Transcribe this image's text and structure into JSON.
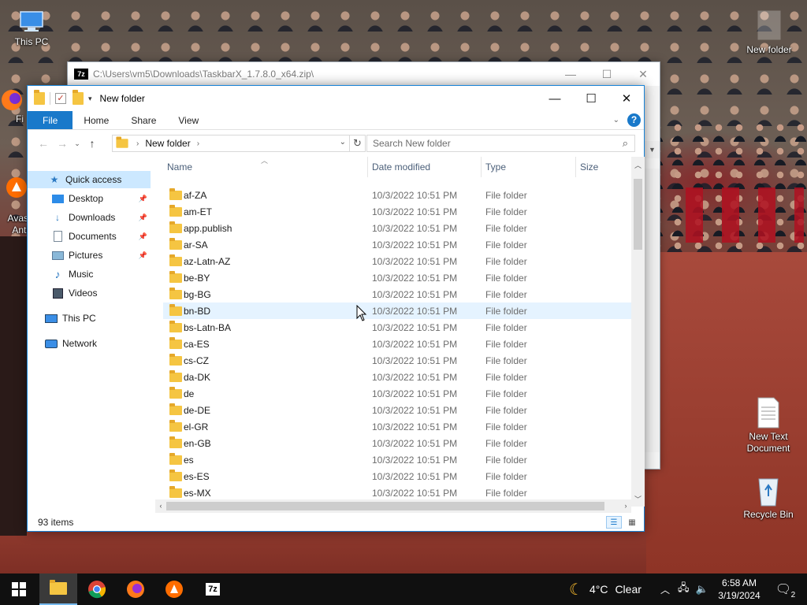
{
  "desktop": {
    "icons": {
      "this_pc": "This PC",
      "new_folder": "New folder",
      "new_text_document": "New Text Document",
      "recycle_bin": "Recycle Bin",
      "avast_partial": "Avas\nAnti",
      "firefox_partial": "Fi"
    }
  },
  "sevenzip_window": {
    "title": "C:\\Users\\vm5\\Downloads\\TaskbarX_1.7.8.0_x64.zip\\",
    "icon_label": "7z"
  },
  "explorer": {
    "title": "New folder",
    "ribbon_tabs": [
      "File",
      "Home",
      "Share",
      "View"
    ],
    "help_label": "?",
    "address": {
      "crumb": "New folder"
    },
    "search_placeholder": "Search New folder",
    "nav_pane": {
      "quick_access": "Quick access",
      "desktop": "Desktop",
      "downloads": "Downloads",
      "documents": "Documents",
      "pictures": "Pictures",
      "music": "Music",
      "videos": "Videos",
      "this_pc": "This PC",
      "network": "Network"
    },
    "columns": {
      "name": "Name",
      "date_modified": "Date modified",
      "type": "Type",
      "size": "Size"
    },
    "rows": [
      {
        "name": "af-ZA",
        "date": "10/3/2022 10:51 PM",
        "type": "File folder"
      },
      {
        "name": "am-ET",
        "date": "10/3/2022 10:51 PM",
        "type": "File folder"
      },
      {
        "name": "app.publish",
        "date": "10/3/2022 10:51 PM",
        "type": "File folder"
      },
      {
        "name": "ar-SA",
        "date": "10/3/2022 10:51 PM",
        "type": "File folder"
      },
      {
        "name": "az-Latn-AZ",
        "date": "10/3/2022 10:51 PM",
        "type": "File folder"
      },
      {
        "name": "be-BY",
        "date": "10/3/2022 10:51 PM",
        "type": "File folder"
      },
      {
        "name": "bg-BG",
        "date": "10/3/2022 10:51 PM",
        "type": "File folder"
      },
      {
        "name": "bn-BD",
        "date": "10/3/2022 10:51 PM",
        "type": "File folder"
      },
      {
        "name": "bs-Latn-BA",
        "date": "10/3/2022 10:51 PM",
        "type": "File folder"
      },
      {
        "name": "ca-ES",
        "date": "10/3/2022 10:51 PM",
        "type": "File folder"
      },
      {
        "name": "cs-CZ",
        "date": "10/3/2022 10:51 PM",
        "type": "File folder"
      },
      {
        "name": "da-DK",
        "date": "10/3/2022 10:51 PM",
        "type": "File folder"
      },
      {
        "name": "de",
        "date": "10/3/2022 10:51 PM",
        "type": "File folder"
      },
      {
        "name": "de-DE",
        "date": "10/3/2022 10:51 PM",
        "type": "File folder"
      },
      {
        "name": "el-GR",
        "date": "10/3/2022 10:51 PM",
        "type": "File folder"
      },
      {
        "name": "en-GB",
        "date": "10/3/2022 10:51 PM",
        "type": "File folder"
      },
      {
        "name": "es",
        "date": "10/3/2022 10:51 PM",
        "type": "File folder"
      },
      {
        "name": "es-ES",
        "date": "10/3/2022 10:51 PM",
        "type": "File folder"
      },
      {
        "name": "es-MX",
        "date": "10/3/2022 10:51 PM",
        "type": "File folder"
      }
    ],
    "hovered_row": "bn-BD",
    "status": {
      "item_count": "93 items"
    }
  },
  "taskbar": {
    "weather_temp": "4°C",
    "weather_cond": "Clear",
    "time": "6:58 AM",
    "date": "3/19/2024",
    "notification_count": "2",
    "sevenzip_label": "7z"
  },
  "colors": {
    "accent": "#1979ca",
    "hover_row": "#e5f3ff",
    "folder": "#f5c542",
    "taskbar": "#101010"
  }
}
